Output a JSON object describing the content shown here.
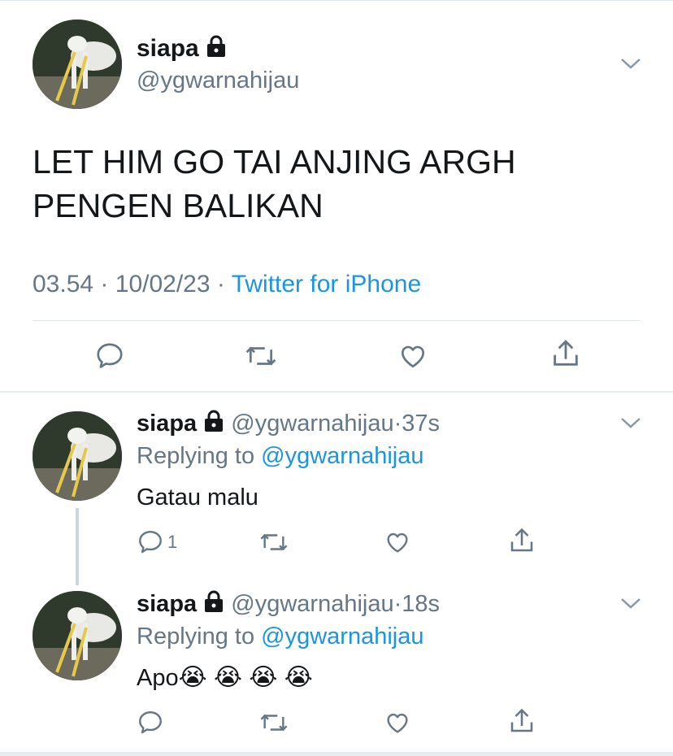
{
  "main_tweet": {
    "display_name": "siapa",
    "handle": "@ygwarnahijau",
    "text_line1": "LET HIM GO TAI ANJING ARGH",
    "text_line2": "PENGEN BALIKAN",
    "time": "03.54",
    "date": "10/02/23",
    "source": "Twitter for iPhone",
    "sep": "·"
  },
  "replies": [
    {
      "display_name": "siapa",
      "handle": "@ygwarnahijau",
      "time_ago": "37s",
      "replying_prefix": "Replying to",
      "replying_to": "@ygwarnahijau",
      "text": "Gatau malu",
      "reply_count": "1",
      "sep": "·"
    },
    {
      "display_name": "siapa",
      "handle": "@ygwarnahijau",
      "time_ago": "18s",
      "replying_prefix": "Replying to",
      "replying_to": "@ygwarnahijau",
      "text": "Apo",
      "emoji": "😭 😭 😭 😭",
      "sep": "·"
    }
  ],
  "icons": {
    "reply": "reply-icon",
    "retweet": "retweet-icon",
    "like": "like-icon",
    "share": "share-icon",
    "lock": "lock-icon",
    "chevron": "chevron-down-icon"
  },
  "colors": {
    "link": "#1b95e0",
    "muted": "#657786",
    "text": "#14171a"
  }
}
